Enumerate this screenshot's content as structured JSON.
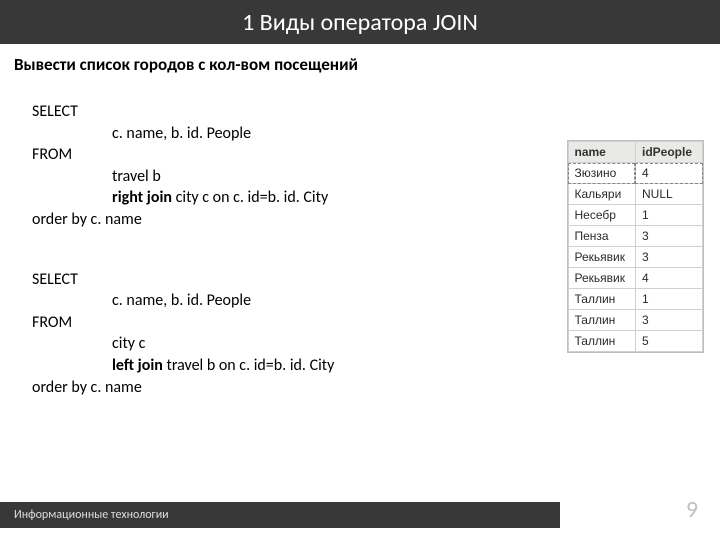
{
  "title": "1 Виды оператора JOIN",
  "subtitle": "Вывести список городов с кол-вом посещений",
  "sql1": {
    "select": "SELECT",
    "cols": "c. name, b. id. People",
    "from": "FROM",
    "src": "travel b",
    "join_pre": "right join ",
    "join_post": "city c on c. id=b. id. City",
    "order": "order by c. name"
  },
  "sql2": {
    "select": "SELECT",
    "cols": "c. name, b. id. People",
    "from": "FROM",
    "src": "city c",
    "join_pre": "left join ",
    "join_post": "travel b on c. id=b. id. City",
    "order": "order by c. name"
  },
  "table": {
    "h1": "name",
    "h2": "idPeople",
    "rows": [
      {
        "name": "Зюзино",
        "id": "4"
      },
      {
        "name": "Кальяри",
        "id": "NULL"
      },
      {
        "name": "Несебр",
        "id": "1"
      },
      {
        "name": "Пенза",
        "id": "3"
      },
      {
        "name": "Рекьявик",
        "id": "3"
      },
      {
        "name": "Рекьявик",
        "id": "4"
      },
      {
        "name": "Таллин",
        "id": "1"
      },
      {
        "name": "Таллин",
        "id": "3"
      },
      {
        "name": "Таллин",
        "id": "5"
      }
    ]
  },
  "footer": "Информационные технологии",
  "page": "9"
}
